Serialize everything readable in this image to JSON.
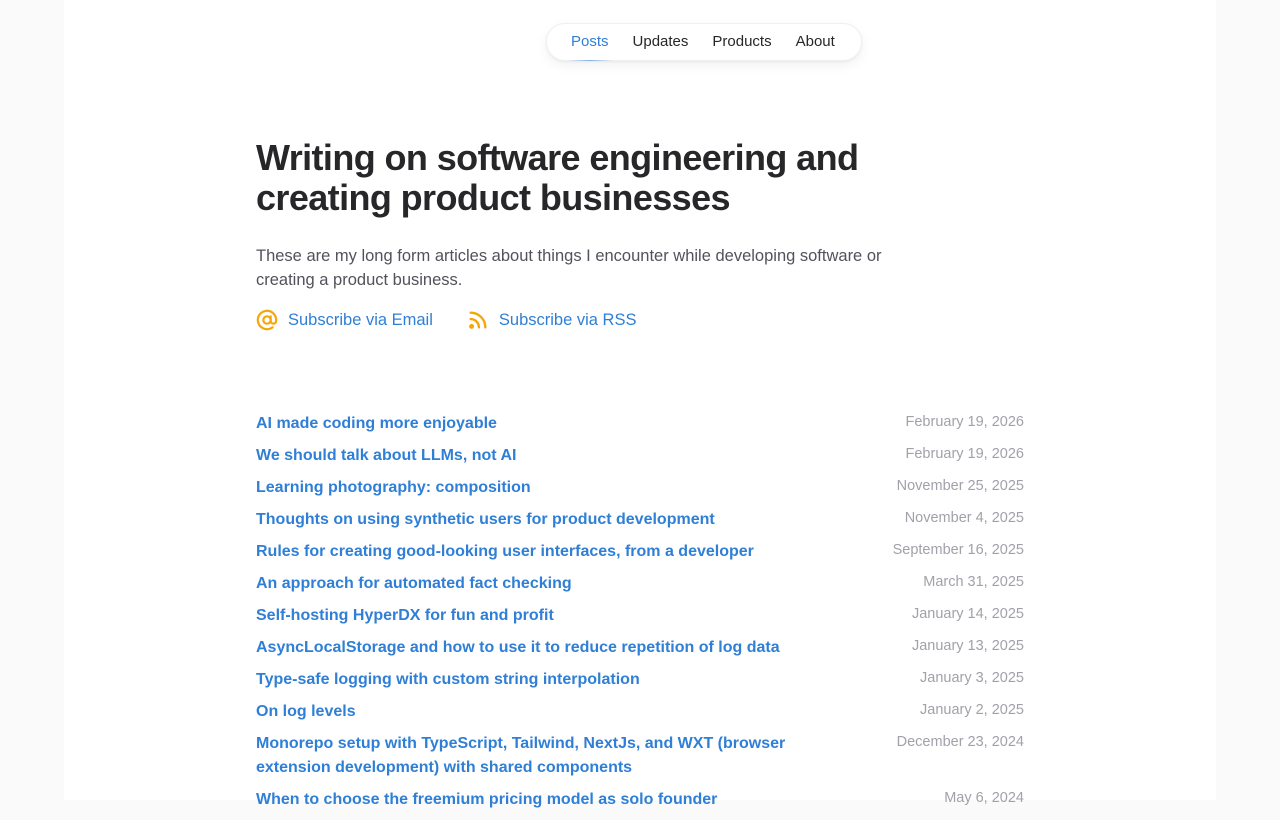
{
  "nav": {
    "items": [
      {
        "label": "Posts",
        "active": true
      },
      {
        "label": "Updates",
        "active": false
      },
      {
        "label": "Products",
        "active": false
      },
      {
        "label": "About",
        "active": false
      }
    ]
  },
  "hero": {
    "title_line1": "Writing on software engineering and",
    "title_line2": "creating product businesses",
    "intro": "These are my long form articles about things I encounter while developing software or creating a product business."
  },
  "subscribe": {
    "email_label": "Subscribe via Email",
    "rss_label": "Subscribe via RSS",
    "icon_color": "#f5a60a"
  },
  "colors": {
    "accent": "#2f7fd6",
    "muted": "#a1a1aa"
  },
  "posts": [
    {
      "title": "AI made coding more enjoyable",
      "date": "February 19, 2026"
    },
    {
      "title": "We should talk about LLMs, not AI",
      "date": "February 19, 2026"
    },
    {
      "title": "Learning photography: composition",
      "date": "November 25, 2025"
    },
    {
      "title": "Thoughts on using synthetic users for product development",
      "date": "November 4, 2025"
    },
    {
      "title": "Rules for creating good-looking user interfaces, from a developer",
      "date": "September 16, 2025"
    },
    {
      "title": "An approach for automated fact checking",
      "date": "March 31, 2025"
    },
    {
      "title": "Self-hosting HyperDX for fun and profit",
      "date": "January 14, 2025"
    },
    {
      "title": "AsyncLocalStorage and how to use it to reduce repetition of log data",
      "date": "January 13, 2025"
    },
    {
      "title": "Type-safe logging with custom string interpolation",
      "date": "January 3, 2025"
    },
    {
      "title": "On log levels",
      "date": "January 2, 2025"
    },
    {
      "title": "Monorepo setup with TypeScript, Tailwind, NextJs, and WXT (browser extension development) with shared components",
      "date": "December 23, 2024"
    },
    {
      "title": "When to choose the freemium pricing model as solo founder",
      "date": "May 6, 2024"
    }
  ]
}
